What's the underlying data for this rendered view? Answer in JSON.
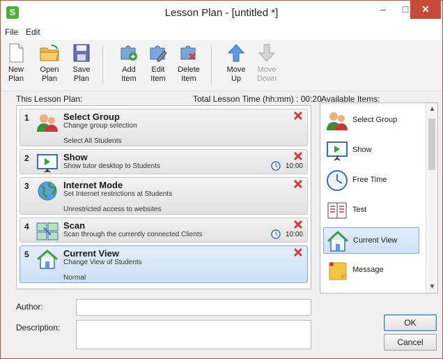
{
  "window": {
    "title": "Lesson Plan - [untitled *]",
    "minimize": "–",
    "maximize": "□",
    "close": "✕"
  },
  "menu": [
    {
      "label": "File"
    },
    {
      "label": "Edit"
    }
  ],
  "toolbar": {
    "new_plan": "New\nPlan",
    "open_plan": "Open\nPlan",
    "save_plan": "Save\nPlan",
    "add_item": "Add\nItem",
    "edit_item": "Edit\nItem",
    "delete_item": "Delete\nItem",
    "move_up": "Move\nUp",
    "move_down": "Move\nDown"
  },
  "plan": {
    "header": "This Lesson Plan:",
    "total_time": "Total Lesson Time (hh:mm) : 00:20",
    "items": [
      {
        "num": "1",
        "name": "Select Group",
        "desc": "Change group selection",
        "sub": "Select All Students",
        "time": ""
      },
      {
        "num": "2",
        "name": "Show",
        "desc": "Show tutor desktop to Students",
        "sub": "",
        "time": "10:00"
      },
      {
        "num": "3",
        "name": "Internet Mode",
        "desc": "Set Internet restrictions at Students",
        "sub": "Unrestricted access to websites",
        "time": ""
      },
      {
        "num": "4",
        "name": "Scan",
        "desc": "Scan through the currently connected Clients",
        "sub": "",
        "time": "10:00"
      },
      {
        "num": "5",
        "name": "Current View",
        "desc": "Change View of Students",
        "sub": "Normal",
        "time": "",
        "selected": true
      }
    ]
  },
  "available": {
    "header": "Available Items:",
    "items": [
      {
        "label": "Select Group",
        "icon": "group-icon"
      },
      {
        "label": "Show",
        "icon": "show-icon"
      },
      {
        "label": "Free Time",
        "icon": "clock-icon"
      },
      {
        "label": "Test",
        "icon": "test-icon"
      },
      {
        "label": "Current View",
        "icon": "current-view-icon",
        "selected": true
      },
      {
        "label": "Message",
        "icon": "message-icon"
      }
    ]
  },
  "form": {
    "author_label": "Author:",
    "author_value": "",
    "description_label": "Description:",
    "description_value": ""
  },
  "buttons": {
    "ok": "OK",
    "cancel": "Cancel"
  },
  "colors": {
    "accent": "#3c7fb1",
    "close_red": "#c84b3a",
    "delete_red": "#d23a3a"
  }
}
